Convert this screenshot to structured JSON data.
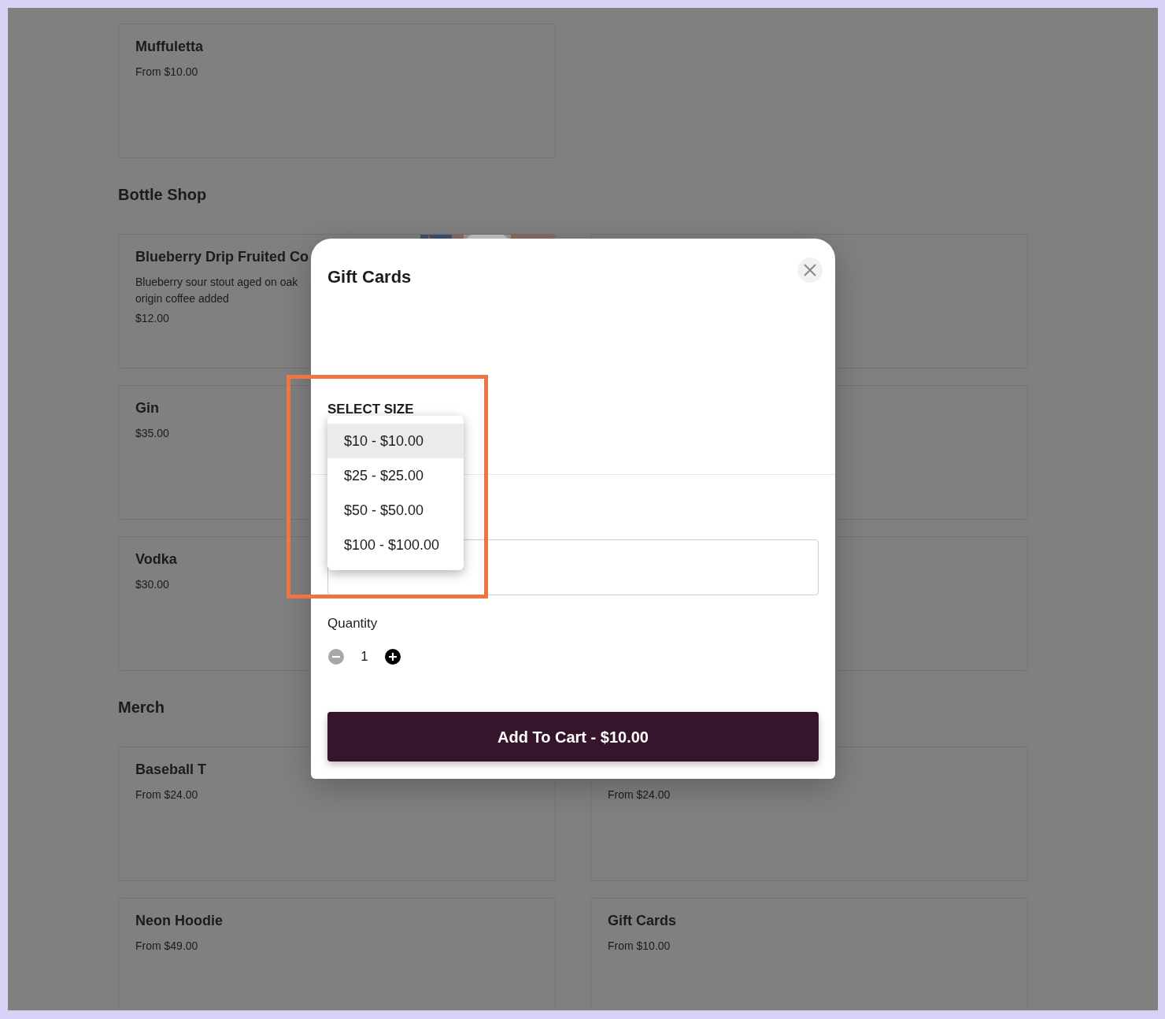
{
  "sections": [
    {
      "items": [
        {
          "kind": "card",
          "name": "Muffuletta",
          "price": "From $10.00"
        }
      ]
    },
    {
      "heading": "Bottle Shop",
      "items": [
        {
          "kind": "card",
          "name": "Blueberry Drip Fruited Co",
          "description": "Blueberry sour stout aged on oak origin coffee added",
          "price": "$12.00"
        },
        {
          "kind": "card"
        },
        {
          "kind": "card",
          "name": "Gin",
          "price": "$35.00"
        },
        {
          "kind": "card"
        },
        {
          "kind": "card",
          "name": "Vodka",
          "price": "$30.00"
        },
        {
          "kind": "card"
        }
      ]
    },
    {
      "heading": "Merch",
      "items": [
        {
          "kind": "card",
          "name": "Baseball T",
          "price": "From $24.00"
        },
        {
          "kind": "card",
          "price": "From $24.00"
        },
        {
          "kind": "card",
          "name": "Neon Hoodie",
          "price": "From $49.00"
        },
        {
          "kind": "card",
          "name": "Gift Cards",
          "price": "From $10.00"
        }
      ]
    }
  ],
  "modal": {
    "title": "Gift Cards",
    "size_label": "SELECT SIZE",
    "size_options": [
      {
        "label": "$10 - $10.00",
        "selected": true
      },
      {
        "label": "$25 - $25.00",
        "selected": false
      },
      {
        "label": "$50 - $50.00",
        "selected": false
      },
      {
        "label": "$100 - $100.00",
        "selected": false
      }
    ],
    "quantity_label": "Quantity",
    "quantity": "1",
    "decrease_disabled": true,
    "add_button": "Add To Cart - $10.00"
  },
  "highlight_box": true
}
